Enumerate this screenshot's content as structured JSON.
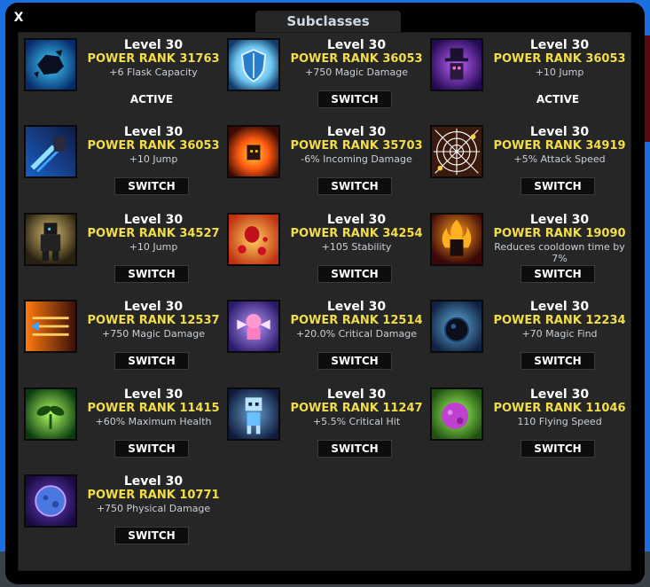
{
  "window": {
    "title": "Subclasses",
    "close_label": "X"
  },
  "subclasses": [
    {
      "level": "Level 30",
      "rank": "POWER RANK 31763",
      "bonus": "+6 Flask Capacity",
      "status": "ACTIVE",
      "icon": "rock-shards-icon"
    },
    {
      "level": "Level 30",
      "rank": "POWER RANK 36053",
      "bonus": "+750 Magic Damage",
      "status": "SWITCH",
      "icon": "ice-shield-icon"
    },
    {
      "level": "Level 30",
      "rank": "POWER RANK 36053",
      "bonus": "+10 Jump",
      "status": "ACTIVE",
      "icon": "wizard-hat-icon"
    },
    {
      "level": "Level 30",
      "rank": "POWER RANK 36053",
      "bonus": "+10 Jump",
      "status": "SWITCH",
      "icon": "comet-dash-icon"
    },
    {
      "level": "Level 30",
      "rank": "POWER RANK 35703",
      "bonus": "-6% Incoming Damage",
      "status": "SWITCH",
      "icon": "fire-burst-icon"
    },
    {
      "level": "Level 30",
      "rank": "POWER RANK 34919",
      "bonus": "+5% Attack Speed",
      "status": "SWITCH",
      "icon": "spider-web-icon"
    },
    {
      "level": "Level 30",
      "rank": "POWER RANK 34527",
      "bonus": "+10 Jump",
      "status": "SWITCH",
      "icon": "shadow-knight-icon"
    },
    {
      "level": "Level 30",
      "rank": "POWER RANK 34254",
      "bonus": "+105 Stability",
      "status": "SWITCH",
      "icon": "red-gems-icon"
    },
    {
      "level": "Level 30",
      "rank": "POWER RANK 19090",
      "bonus": "Reduces cooldown time by 7%",
      "status": "SWITCH",
      "icon": "flame-hero-icon"
    },
    {
      "level": "Level 30",
      "rank": "POWER RANK 12537",
      "bonus": "+750 Magic Damage",
      "status": "SWITCH",
      "icon": "fire-arrows-icon"
    },
    {
      "level": "Level 30",
      "rank": "POWER RANK 12514",
      "bonus": "+20.0% Critical Damage",
      "status": "SWITCH",
      "icon": "pink-fairy-icon"
    },
    {
      "level": "Level 30",
      "rank": "POWER RANK 12234",
      "bonus": "+70 Magic Find",
      "status": "SWITCH",
      "icon": "dark-orb-icon"
    },
    {
      "level": "Level 30",
      "rank": "POWER RANK 11415",
      "bonus": "+60% Maximum Health",
      "status": "SWITCH",
      "icon": "green-sprout-icon"
    },
    {
      "level": "Level 30",
      "rank": "POWER RANK 11247",
      "bonus": "+5.5% Critical Hit",
      "status": "SWITCH",
      "icon": "ice-skeleton-icon"
    },
    {
      "level": "Level 30",
      "rank": "POWER RANK 11046",
      "bonus": "110 Flying Speed",
      "status": "SWITCH",
      "icon": "purple-meteor-icon"
    },
    {
      "level": "Level 30",
      "rank": "POWER RANK 10771",
      "bonus": "+750 Physical Damage",
      "status": "SWITCH",
      "icon": "violet-planet-icon"
    }
  ]
}
